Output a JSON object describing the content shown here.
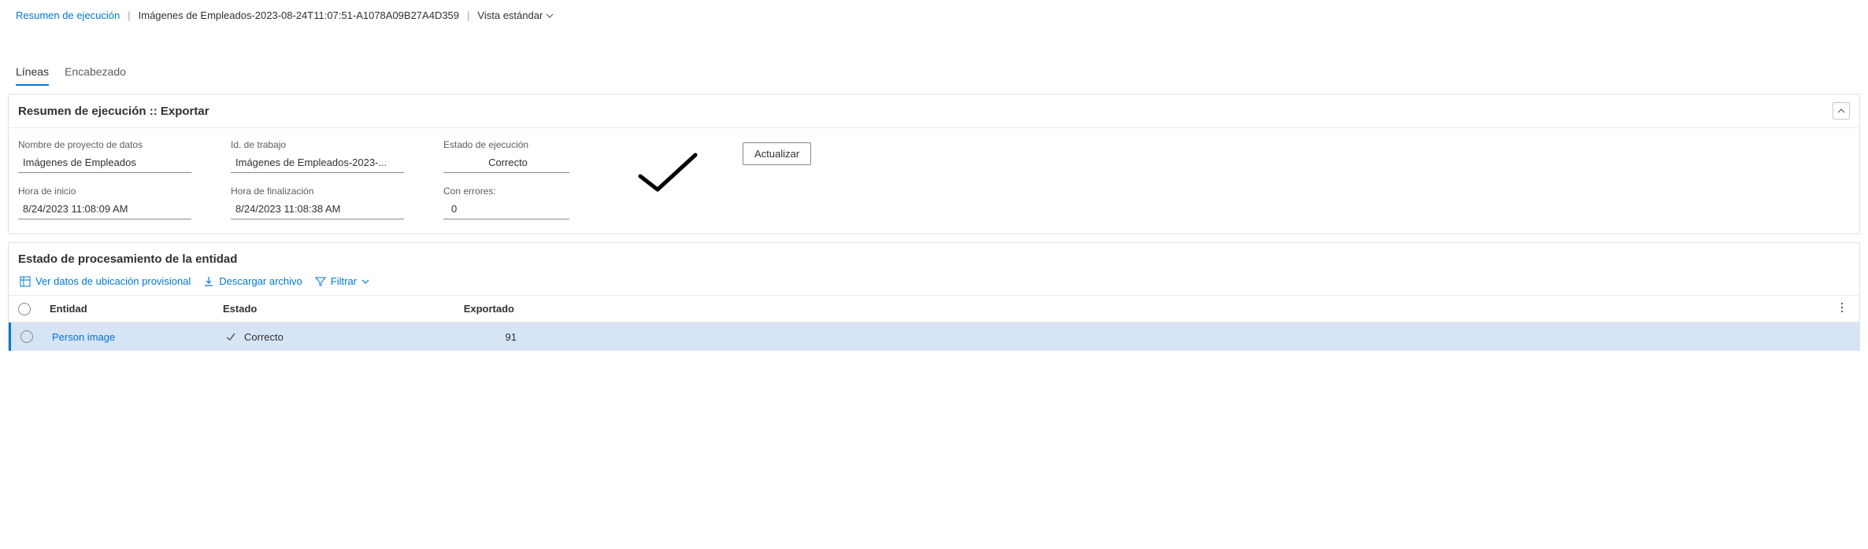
{
  "breadcrumb": {
    "link": "Resumen de ejecución",
    "title": "Imágenes de Empleados-2023-08-24T11:07:51-A1078A09B27A4D359",
    "view": "Vista estándar"
  },
  "tabs": {
    "lines": "Líneas",
    "header": "Encabezado"
  },
  "summary": {
    "title": "Resumen de ejecución :: Exportar",
    "fields": {
      "project_label": "Nombre de proyecto de datos",
      "project_value": "Imágenes de Empleados",
      "jobid_label": "Id. de trabajo",
      "jobid_value": "Imágenes de Empleados-2023-...",
      "status_label": "Estado de ejecución",
      "status_value": "Correcto",
      "start_label": "Hora de inicio",
      "start_value": "8/24/2023 11:08:09 AM",
      "end_label": "Hora de finalización",
      "end_value": "8/24/2023 11:08:38 AM",
      "errors_label": "Con errores:",
      "errors_value": "0"
    },
    "refresh_button": "Actualizar"
  },
  "entity": {
    "title": "Estado de procesamiento de la entidad",
    "toolbar": {
      "view_staging": "Ver datos de ubicación provisional",
      "download": "Descargar archivo",
      "filter": "Filtrar"
    },
    "columns": {
      "entity": "Entidad",
      "state": "Estado",
      "exported": "Exportado"
    },
    "rows": [
      {
        "entity": "Person image",
        "state": "Correcto",
        "exported": "91"
      }
    ]
  }
}
